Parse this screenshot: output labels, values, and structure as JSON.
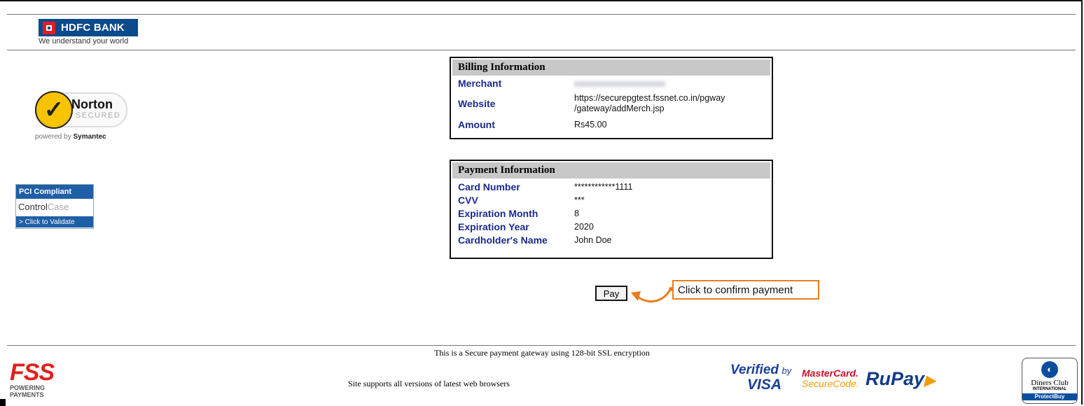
{
  "header": {
    "bank_name": "HDFC BANK",
    "tagline": "We understand your world"
  },
  "badges": {
    "norton_word": "Norton",
    "norton_secured": "SECURED",
    "norton_powered": "powered by",
    "norton_symantec": "Symantec",
    "pci_title": "PCI Compliant",
    "pci_brand_a": "Control",
    "pci_brand_b": "Case",
    "pci_validate": "> Click to Validate"
  },
  "billing": {
    "title": "Billing Information",
    "rows": [
      {
        "label": "Merchant",
        "value": ""
      },
      {
        "label": "Website",
        "value": "https://securepgtest.fssnet.co.in/pgway /gateway/addMerch.jsp"
      },
      {
        "label": "Amount",
        "value": "Rs45.00"
      }
    ]
  },
  "payment": {
    "title": "Payment Information",
    "rows": [
      {
        "label": "Card Number",
        "value": "************1111"
      },
      {
        "label": "CVV",
        "value": "***"
      },
      {
        "label": "Expiration Month",
        "value": "8"
      },
      {
        "label": "Expiration Year",
        "value": "2020"
      },
      {
        "label": "Cardholder's Name",
        "value": "John Doe"
      }
    ]
  },
  "actions": {
    "pay_label": "Pay",
    "callout": "Click to confirm payment"
  },
  "footer": {
    "secure_text": "This is a Secure payment gateway using 128-bit SSL encryption",
    "browsers_text": "Site supports all versions of latest web browsers",
    "fss_word": "FSS",
    "fss_line1": "POWERING",
    "fss_line2": "PAYMENTS",
    "vbv_verified": "Verified",
    "vbv_by": "by",
    "vbv_visa": "VISA",
    "mc_name": "MasterCard.",
    "mc_sub": "SecureCode.",
    "rupay": "RuPay",
    "diners_name": "Diners Club",
    "diners_int": "INTERNATIONAL",
    "diners_pb": "ProtectBuy"
  },
  "colors": {
    "label_blue": "#1a2a8c",
    "hdfc_blue": "#0b4a8b",
    "callout_orange": "#ea7d1e"
  }
}
